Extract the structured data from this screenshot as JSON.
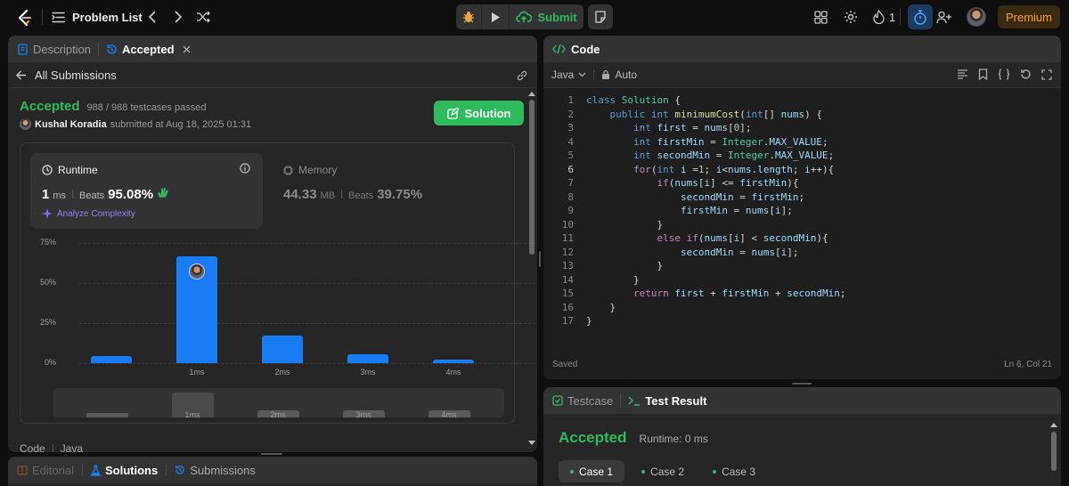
{
  "topbar": {
    "problem_list": "Problem List",
    "submit": "Submit",
    "streak_count": "1",
    "premium": "Premium"
  },
  "left": {
    "tab_description": "Description",
    "tab_accepted": "Accepted",
    "all_submissions": "All Submissions",
    "status": "Accepted",
    "testcases": "988 / 988 testcases passed",
    "user": "Kushal Koradia",
    "submitted_at": "submitted at Aug 18, 2025 01:31",
    "solution_btn": "Solution",
    "runtime": {
      "label": "Runtime",
      "value": "1",
      "unit": "ms",
      "beats_label": "Beats",
      "beats": "95.08%",
      "analyze": "Analyze Complexity"
    },
    "memory": {
      "label": "Memory",
      "value": "44.33",
      "unit": "MB",
      "beats_label": "Beats",
      "beats": "39.75%"
    },
    "code_label": "Code",
    "lang_label": "Java"
  },
  "chart_data": {
    "type": "bar",
    "categories": [
      "",
      "1ms",
      "2ms",
      "3ms",
      "4ms"
    ],
    "values": [
      4.5,
      66.5,
      17.5,
      5.5,
      2.5
    ],
    "y_ticks": [
      "75%",
      "50%",
      "25%",
      "0%"
    ],
    "ylim": [
      0,
      75
    ],
    "highlight_index": 1,
    "grid": true
  },
  "minimap": {
    "labels": [
      "1ms",
      "2ms",
      "3ms",
      "4ms"
    ]
  },
  "bottom_tabs": {
    "editorial": "Editorial",
    "solutions": "Solutions",
    "submissions": "Submissions"
  },
  "code": {
    "title": "Code",
    "language": "Java",
    "mode": "Auto",
    "lines": [
      "class Solution {",
      "    public int minimumCost(int[] nums) {",
      "        int first = nums[0];",
      "        int firstMin = Integer.MAX_VALUE;",
      "        int secondMin = Integer.MAX_VALUE;",
      "        for(int i =1; i<nums.length; i++){",
      "            if(nums[i] <= firstMin){",
      "                secondMin = firstMin;",
      "                firstMin = nums[i];",
      "            }",
      "            else if(nums[i] < secondMin){",
      "                secondMin = nums[i];",
      "            }",
      "        }",
      "        return first + firstMin + secondMin;",
      "    }",
      "}"
    ],
    "saved": "Saved",
    "cursor": "Ln 6, Col 21"
  },
  "result": {
    "tab_testcase": "Testcase",
    "tab_result": "Test Result",
    "status": "Accepted",
    "runtime": "Runtime: 0 ms",
    "cases": [
      "Case 1",
      "Case 2",
      "Case 3"
    ]
  },
  "colors": {
    "accent_green": "#2cbb5d",
    "accent_blue": "#1a7cf5",
    "premium": "#ffa116"
  }
}
